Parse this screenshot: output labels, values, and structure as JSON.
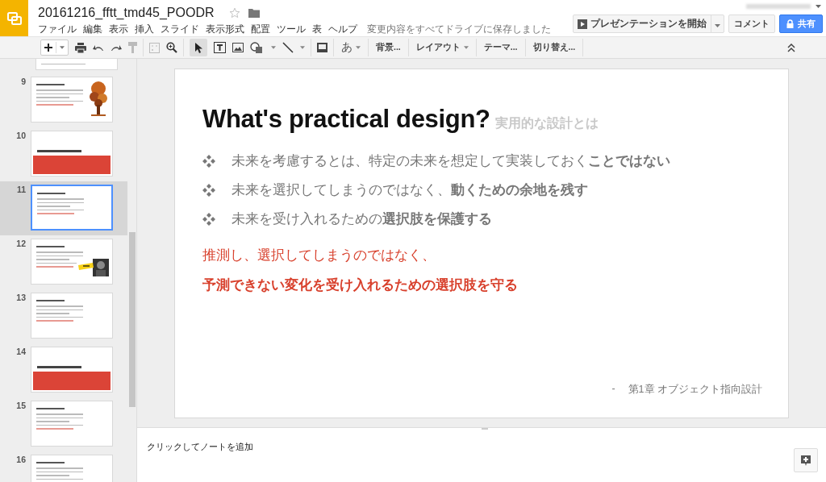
{
  "document": {
    "title": "20161216_fftt_tmd45_POODR",
    "starred": false,
    "save_status": "変更内容をすべてドライブに保存しました"
  },
  "menu": [
    "ファイル",
    "編集",
    "表示",
    "挿入",
    "スライド",
    "表示形式",
    "配置",
    "ツール",
    "表",
    "ヘルプ"
  ],
  "actions": {
    "present": "プレゼンテーションを開始",
    "comment": "コメント",
    "share": "共有"
  },
  "toolbar": {
    "input_tools": "あ",
    "items": [
      {
        "label": "背景...",
        "dropdown": false
      },
      {
        "label": "レイアウト",
        "dropdown": true
      },
      {
        "label": "テーマ...",
        "dropdown": false
      },
      {
        "label": "切り替え...",
        "dropdown": false
      }
    ]
  },
  "slides": [
    {
      "number": "9",
      "kind": "figure",
      "selected": false
    },
    {
      "number": "10",
      "kind": "section",
      "selected": false
    },
    {
      "number": "11",
      "kind": "content",
      "selected": true
    },
    {
      "number": "12",
      "selected": false
    },
    {
      "number": "13",
      "kind": "content",
      "selected": false
    },
    {
      "number": "14",
      "kind": "section",
      "selected": false
    },
    {
      "number": "15",
      "kind": "content",
      "selected": false
    },
    {
      "number": "16",
      "kind": "content",
      "selected": false
    }
  ],
  "current_slide": {
    "title": "What's practical design?",
    "subtitle": "実用的な設計とは",
    "bullets": [
      "未来を考慮するとは、特定の未来を想定して実装しておく**ことではない**",
      "未来を選択してしまうのではなく、**動くための余地を残す**",
      "未来を受け入れるための**選択肢を保護する**"
    ],
    "emphasis": [
      "推測し、選択してしまうのではなく、",
      "**予測できない変化を受け入れるための選択肢を守る**"
    ],
    "footer_dash": "-",
    "footer": "第1章 オブジェクト指向設計"
  },
  "notes": {
    "placeholder": "クリックしてノートを追加"
  }
}
